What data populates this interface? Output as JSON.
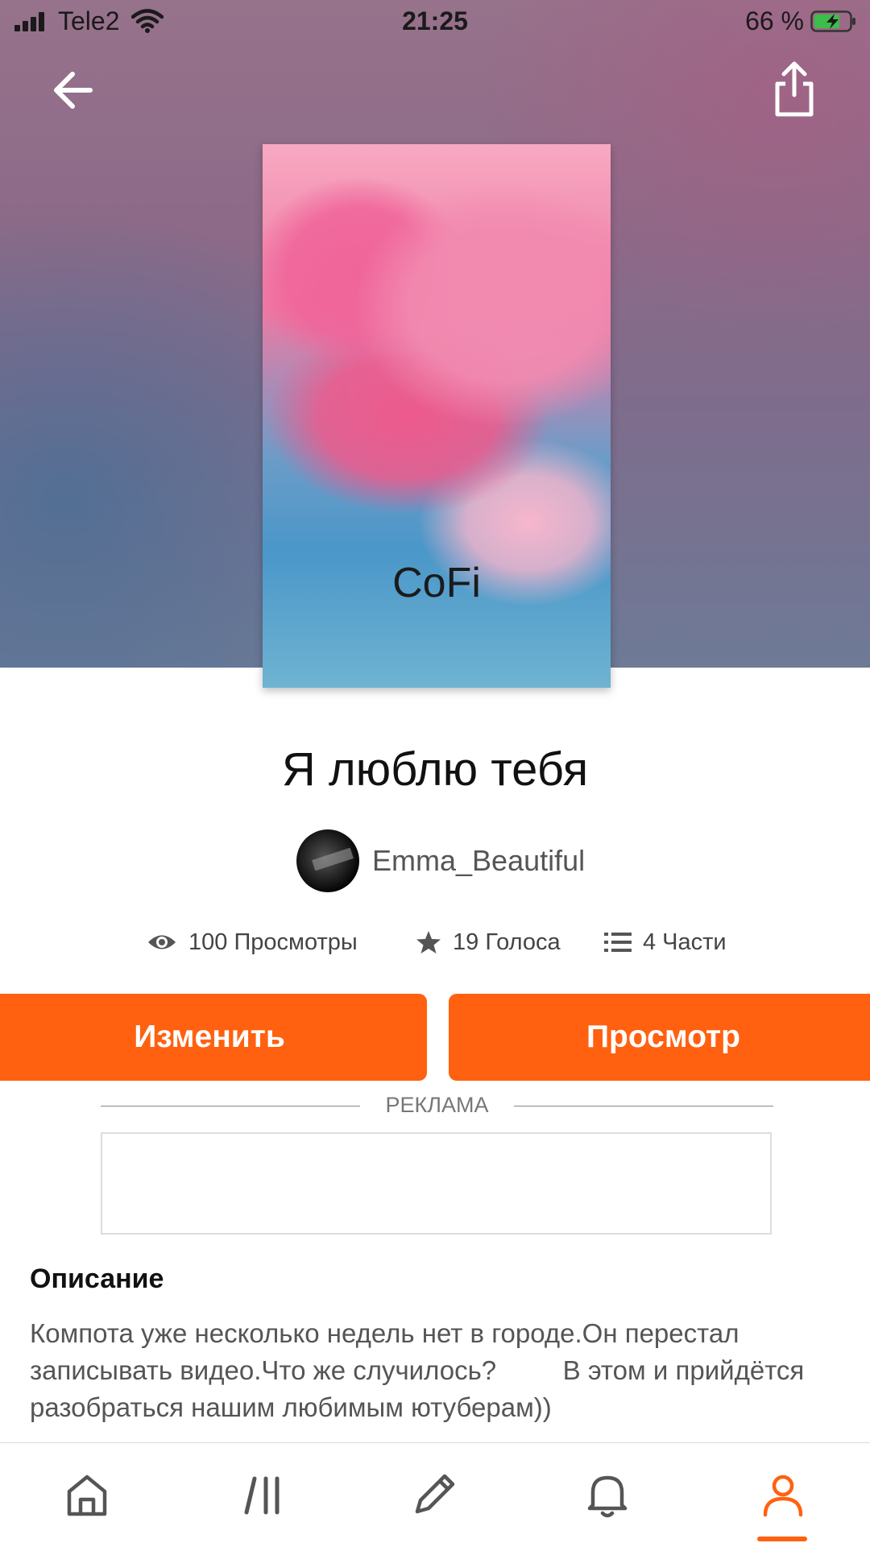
{
  "status_bar": {
    "carrier": "Tele2",
    "time": "21:25",
    "battery_percent": "66 %"
  },
  "header": {
    "back_icon": "arrow-left-icon",
    "share_icon": "share-icon"
  },
  "cover": {
    "title": "CoFi"
  },
  "story": {
    "title": "Я люблю тебя",
    "author": "Emma_Beautiful",
    "stats": {
      "views": "100 Просмотры",
      "votes": "19 Голоса",
      "parts": "4 Части"
    }
  },
  "actions": {
    "edit_label": "Изменить",
    "view_label": "Просмотр"
  },
  "ad": {
    "label": "РЕКЛАМА"
  },
  "description": {
    "heading": "Описание",
    "text": "Компота уже несколько недель нет в городе.Он перестал записывать видео.Что же случилось?         В этом и прийдётся разобраться нашим любимым ютуберам))"
  },
  "colors": {
    "accent": "#ff6110"
  },
  "bottom_nav": {
    "items": [
      "home-icon",
      "library-icon",
      "pencil-icon",
      "bell-icon",
      "profile-icon"
    ],
    "active": "profile-icon"
  }
}
